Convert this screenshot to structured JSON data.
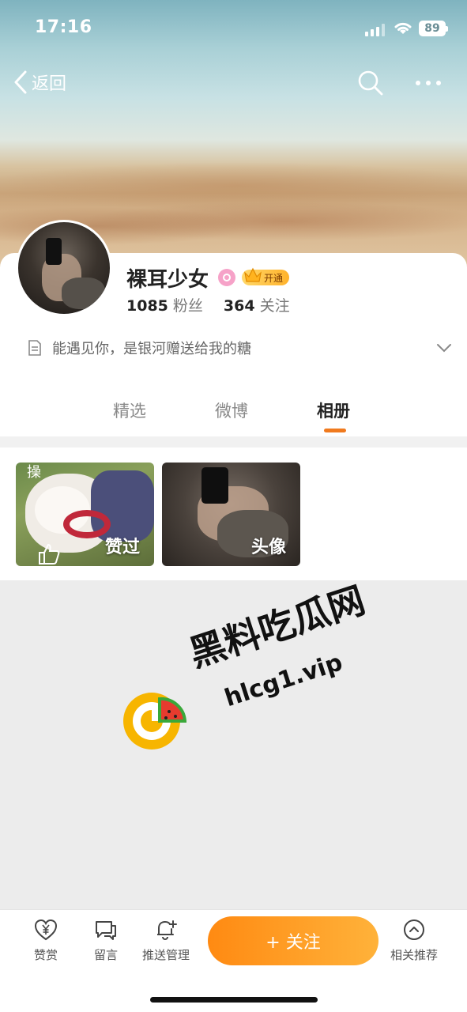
{
  "status": {
    "time": "17:16",
    "battery": "89"
  },
  "nav": {
    "back_label": "返回"
  },
  "profile": {
    "name": "裸耳少女",
    "vip_label": "开通",
    "followers_count": "1085",
    "followers_label": "粉丝",
    "following_count": "364",
    "following_label": "关注",
    "bio": "能遇见你，是银河赠送给我的糖"
  },
  "tabs": [
    {
      "label": "精选",
      "active": false
    },
    {
      "label": "微博",
      "active": false
    },
    {
      "label": "相册",
      "active": true
    }
  ],
  "album": {
    "tiles": [
      {
        "label": "赞过",
        "corner_text": "操"
      },
      {
        "label": "头像"
      }
    ]
  },
  "watermark": {
    "title": "黑料吃瓜网",
    "url": "hlcg1.vip"
  },
  "bottom_bar": {
    "items": [
      {
        "label": "赞赏",
        "icon": "heart-yen-icon"
      },
      {
        "label": "留言",
        "icon": "chat-bubble-icon"
      },
      {
        "label": "推送管理",
        "icon": "bell-plus-icon"
      },
      {
        "label": "相关推荐",
        "icon": "chevron-up-circle-icon"
      }
    ],
    "follow_label": "+ 关注"
  },
  "colors": {
    "accent": "#f07a1e",
    "follow_button": "#ff9a22",
    "vip_gold": "#ffc04a"
  }
}
